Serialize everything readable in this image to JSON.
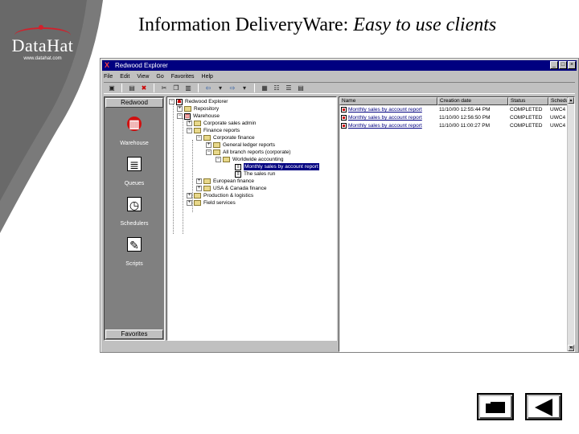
{
  "slide": {
    "title_main": "Information DeliveryWare:",
    "title_italic": "Easy to use clients"
  },
  "logo": {
    "name": "DataHat",
    "url": "www.datahat.com"
  },
  "window": {
    "title": "Redwood Explorer",
    "controls": [
      "_",
      "□",
      "×"
    ]
  },
  "menu": [
    "File",
    "Edit",
    "View",
    "Go",
    "Favorites",
    "Help"
  ],
  "sidebar": {
    "header": "Redwood",
    "footer": "Favorites",
    "items": [
      {
        "label": "Warehouse",
        "icon": "warehouse-icon"
      },
      {
        "label": "Queues",
        "icon": "queue-icon"
      },
      {
        "label": "Schedulers",
        "icon": "scheduler-icon"
      },
      {
        "label": "Scripts",
        "icon": "script-icon"
      }
    ]
  },
  "tree": [
    {
      "label": "Redwood Explorer"
    },
    {
      "label": "Repository"
    },
    {
      "label": "Warehouse"
    },
    {
      "label": "Corporate sales admin"
    },
    {
      "label": "Finance reports"
    },
    {
      "label": "Corporate finance"
    },
    {
      "label": "General ledger reports"
    },
    {
      "label": "All branch reports (corporate)"
    },
    {
      "label": "Worldwide accounting"
    },
    {
      "label": "Monthly sales by account report"
    },
    {
      "label": "The sales run"
    },
    {
      "label": "European finance"
    },
    {
      "label": "USA & Canada finance"
    },
    {
      "label": "Production & logistics"
    },
    {
      "label": "Field services"
    }
  ],
  "list": {
    "columns": [
      "Name",
      "Creation date",
      "Status",
      "Scheduler"
    ],
    "rows": [
      [
        "Monthly sales by account report",
        "11/10/00 12:55:44 PM",
        "COMPLETED",
        "UWC4"
      ],
      [
        "Monthly sales by account report",
        "11/10/00 12:56:50 PM",
        "COMPLETED",
        "UWC4"
      ],
      [
        "Monthly sales by account report",
        "11/10/00 11:00:27 PM",
        "COMPLETED",
        "UWC4"
      ]
    ]
  },
  "colors": {
    "titlebar": "#000080",
    "chrome": "#c0c0c0",
    "sidebar": "#808080",
    "logo_band": "#7a7a7a",
    "accent": "#d2202b"
  }
}
